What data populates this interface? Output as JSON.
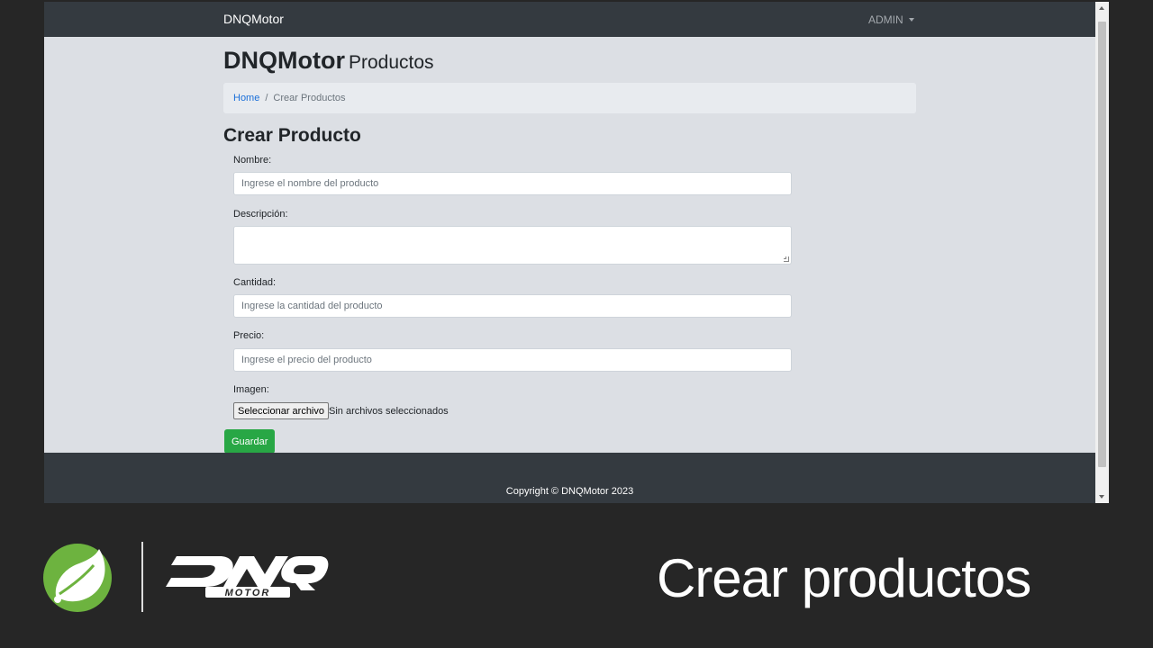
{
  "navbar": {
    "brand": "DNQMotor",
    "user_menu": "ADMIN"
  },
  "page_title": {
    "main": "DNQMotor",
    "sub": "Productos"
  },
  "breadcrumb": {
    "home": "Home",
    "separator": "/",
    "current": "Crear Productos"
  },
  "form": {
    "title": "Crear Producto",
    "nombre": {
      "label": "Nombre:",
      "placeholder": "Ingrese el nombre del producto"
    },
    "descripcion": {
      "label": "Descripción:"
    },
    "cantidad": {
      "label": "Cantidad:",
      "placeholder": "Ingrese la cantidad del producto"
    },
    "precio": {
      "label": "Precio:",
      "placeholder": "Ingrese el precio del producto"
    },
    "imagen": {
      "label": "Imagen:",
      "button": "Seleccionar archivo",
      "status": "Sin archivos seleccionados"
    },
    "submit": "Guardar"
  },
  "footer": {
    "copyright": "Copyright © DNQMotor 2023"
  },
  "slide": {
    "caption": "Crear productos",
    "logo_text": "DNQ MOTOR"
  },
  "colors": {
    "navbar": "#343a40",
    "primary_link": "#1a6fd9",
    "success": "#28a745",
    "spring_green": "#6db33f"
  }
}
